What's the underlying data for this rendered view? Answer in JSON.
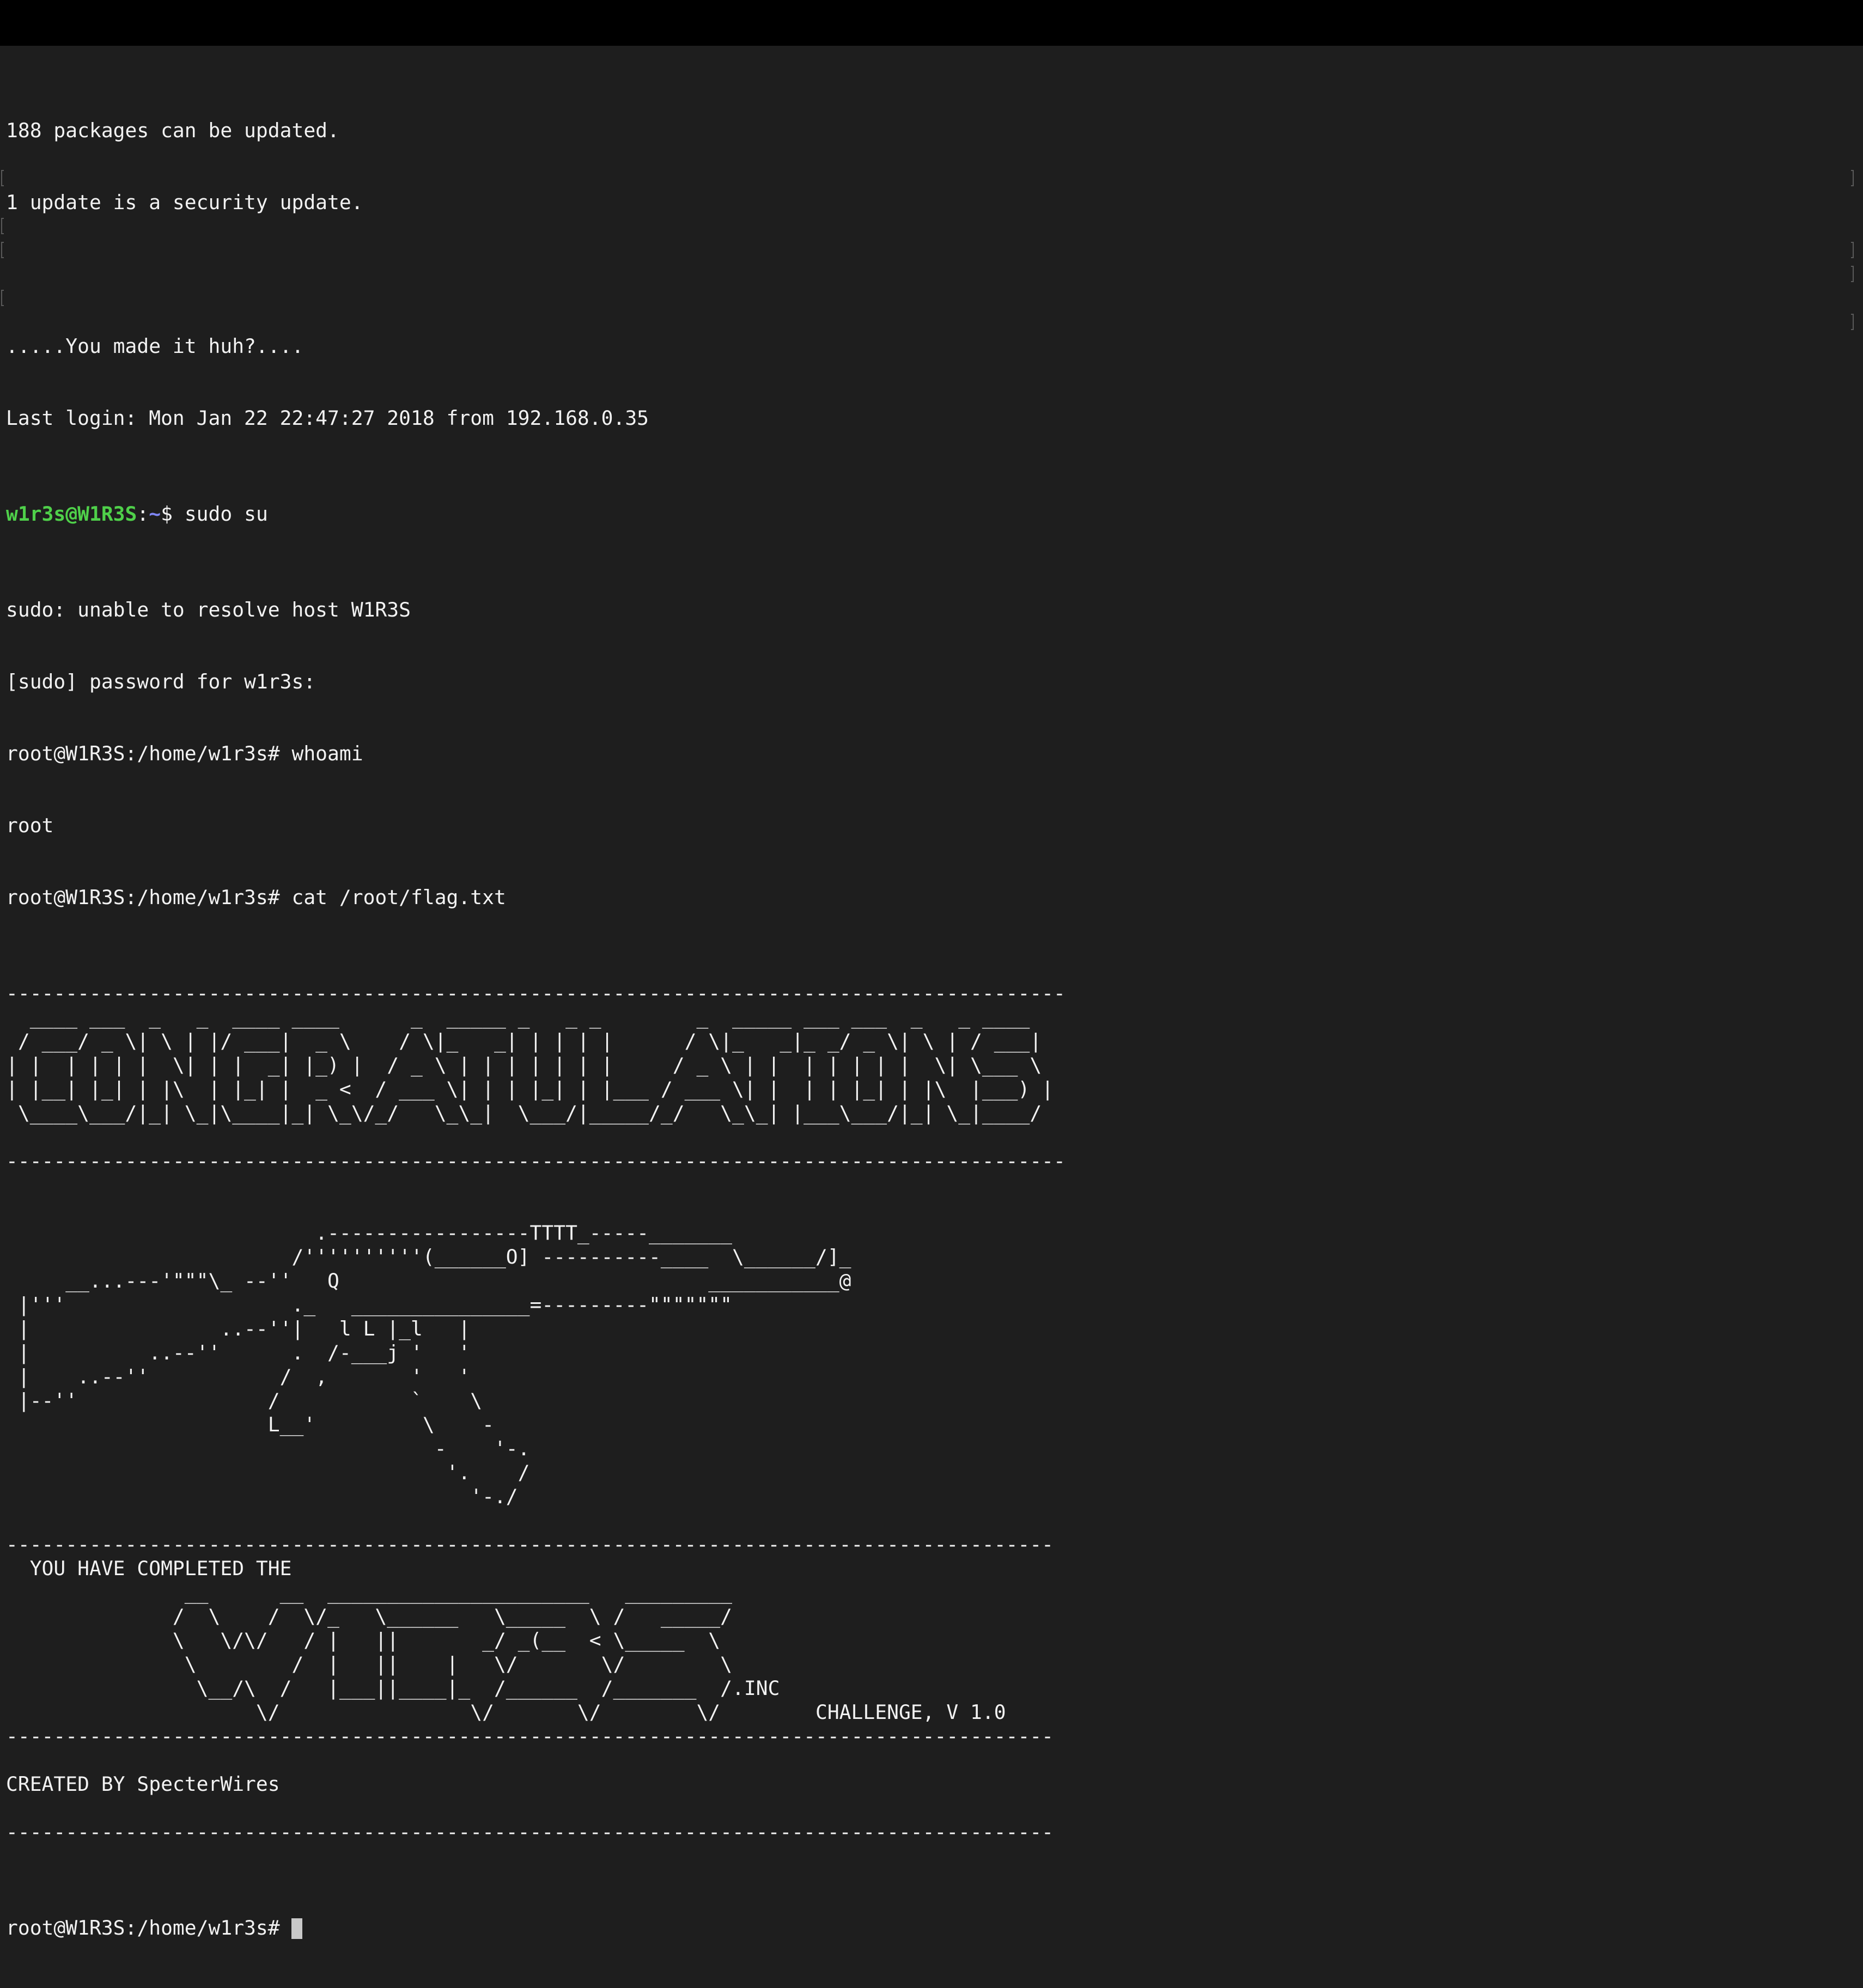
{
  "colors": {
    "background": "#1e1e1e",
    "titlebar": "#000000",
    "text": "#f2f2f2",
    "user_host": "#4fd04a",
    "path": "#7f86f5",
    "cursor": "#c8c8c8"
  },
  "terminal": {
    "motd": [
      "188 packages can be updated.",
      "1 update is a security update.",
      "",
      ".....You made it huh?....",
      "Last login: Mon Jan 22 22:47:27 2018 from 192.168.0.35"
    ],
    "prompt1": {
      "user_host": "w1r3s@W1R3S",
      "colon": ":",
      "path": "~",
      "symbol": "$ ",
      "command": "sudo su"
    },
    "output1": [
      "sudo: unable to resolve host W1R3S",
      "[sudo] password for w1r3s:"
    ],
    "prompt2": "root@W1R3S:/home/w1r3s# whoami",
    "output2": "root",
    "prompt3": "root@W1R3S:/home/w1r3s# cat /root/flag.txt",
    "flag_lines": [
      "-----------------------------------------------------------------------------------------",
      "  ____ ___  _   _  ____ ____      _  _____ _   _ _        _  _____ ___ ___  _   _ ____  ",
      " / ___/ _ \\| \\ | |/ ___|  _ \\    / \\|_   _| | | | |      / \\|_   _|_ _/ _ \\| \\ | / ___| ",
      "| |  | | | |  \\| | |  _| |_) |  / _ \\ | | | | | | |     / _ \\ | |  | | | | |  \\| \\___ \\ ",
      "| |__| |_| | |\\  | |_| |  _ <  / ___ \\| | | |_| | |___ / ___ \\| |  | | |_| | |\\  |___) |",
      " \\____\\___/|_| \\_|\\____|_| \\_\\/_/   \\_\\_|  \\___/|_____/_/   \\_\\_| |___\\___/|_| \\_|____/ ",
      "",
      "-----------------------------------------------------------------------------------------",
      "",
      "",
      "                          .-----------------TTTT_-----_______",
      "                        /''''''''''(______O] ----------____  \\______/]_",
      "     __...---'\"\"\"\\_ --''   Q                               ___________@",
      " |'''                   ._   _______________=---------\"\"\"\"\"\"\"",
      " |                ..--''|   l L |_l   |",
      " |          ..--''      .  /-___j '   '",
      " |    ..--''           /  ,       '   '",
      " |--''                /           `    \\",
      "                      L__'         \\    -",
      "                                    -    '-.",
      "                                     '.    /",
      "                                       '-./",
      "",
      "----------------------------------------------------------------------------------------",
      "  YOU HAVE COMPLETED THE",
      "               __      __  ______________________   _________",
      "              /  \\    /  \\/_   \\______   \\_____  \\ /   _____/",
      "              \\   \\/\\/   / |   ||       _/ _(__  < \\_____  \\",
      "               \\        /  |   ||    |   \\/       \\/        \\",
      "                \\__/\\  /   |___||____|_  /______  /_______  /.INC",
      "                     \\/                \\/       \\/        \\/        CHALLENGE, V 1.0",
      "----------------------------------------------------------------------------------------",
      "",
      "CREATED BY SpecterWires",
      "",
      "----------------------------------------------------------------------------------------"
    ],
    "final_prompt": "root@W1R3S:/home/w1r3s# "
  }
}
